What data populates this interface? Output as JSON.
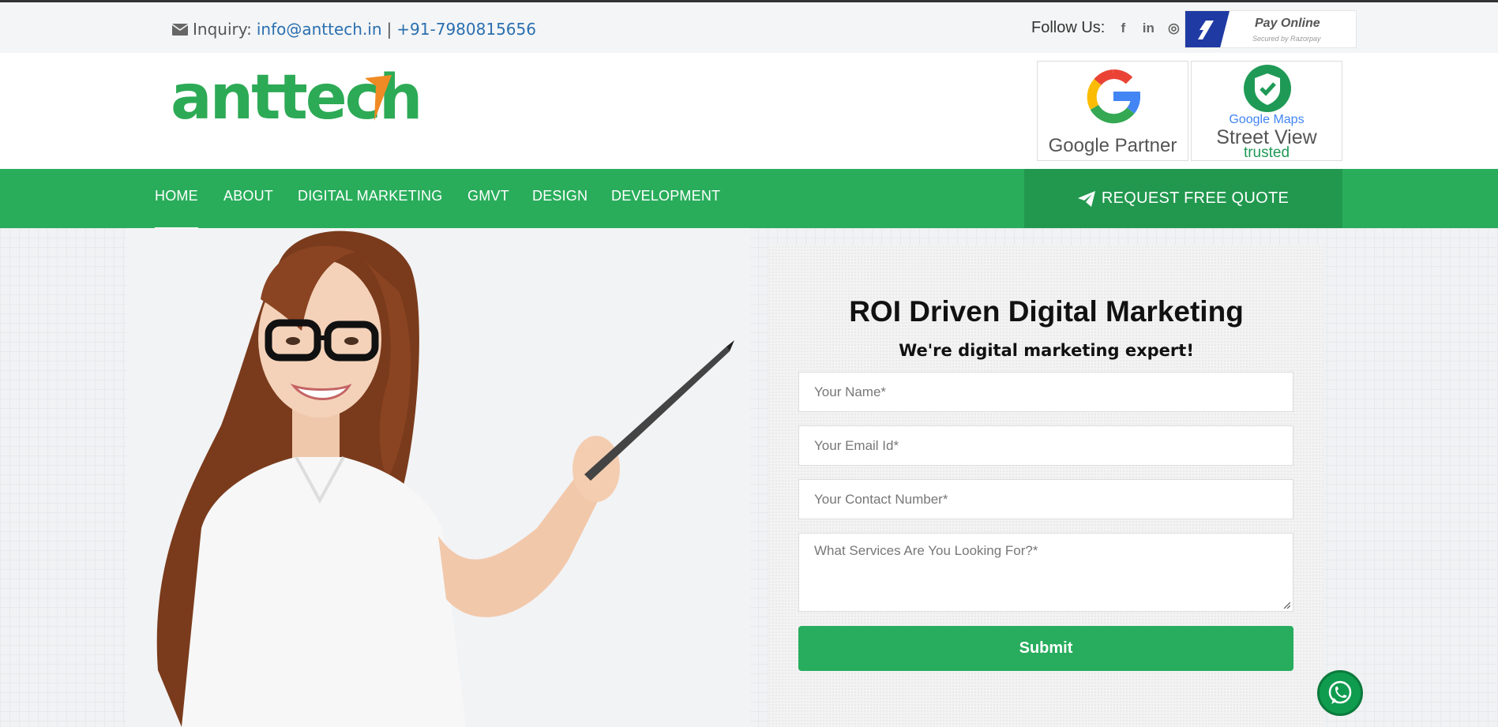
{
  "topbar": {
    "inquiry_label": "Inquiry:",
    "email": "info@anttech.in",
    "separator": "|",
    "phone": "+91-7980815656",
    "follow_label": "Follow Us:",
    "social": [
      "f",
      "in",
      "◎"
    ],
    "pay_title": "Pay Online",
    "pay_subtitle": "Secured by Razorpay"
  },
  "header": {
    "logo_text": "anttech",
    "badges": [
      {
        "caption": "Google Partner"
      },
      {
        "caption_small": "Google Maps",
        "caption": "Street View",
        "caption_tag": "trusted"
      }
    ]
  },
  "nav": {
    "items": [
      "HOME",
      "ABOUT",
      "DIGITAL MARKETING",
      "GMVT",
      "DESIGN",
      "DEVELOPMENT"
    ],
    "quote_label": "REQUEST FREE QUOTE"
  },
  "form": {
    "title": "ROI Driven Digital Marketing",
    "subtitle": "We're digital marketing expert!",
    "name_placeholder": "Your Name*",
    "email_placeholder": "Your Email Id*",
    "phone_placeholder": "Your Contact Number*",
    "services_placeholder": "What Services Are You Looking For?*",
    "submit_label": "Submit"
  },
  "colors": {
    "brand_green": "#29ad5b",
    "brand_orange": "#f08a24",
    "link_blue": "#2a6fb0"
  }
}
